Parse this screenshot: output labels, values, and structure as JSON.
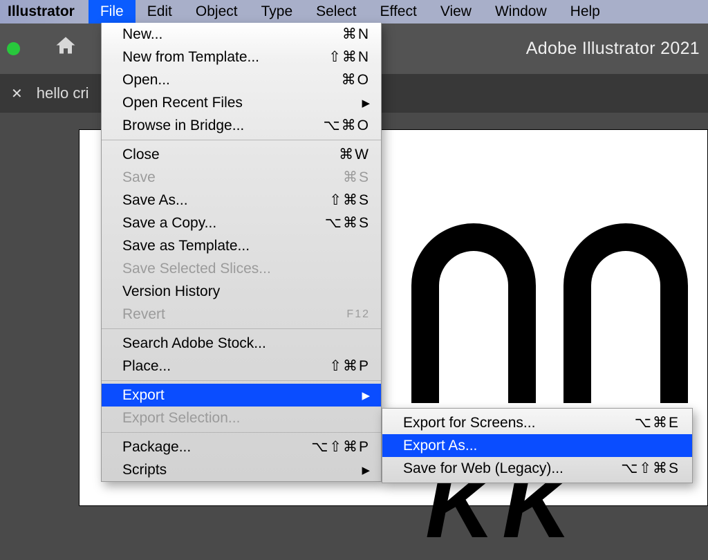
{
  "menubar": {
    "brand": "Illustrator",
    "items": [
      "File",
      "Edit",
      "Object",
      "Type",
      "Select",
      "Effect",
      "View",
      "Window",
      "Help"
    ],
    "active": "File"
  },
  "header": {
    "app_title": "Adobe Illustrator 2021"
  },
  "tabs": {
    "close_glyph": "✕",
    "active_tab": "hello cri"
  },
  "menu": {
    "items": [
      {
        "label": "New...",
        "shortcut": "⌘N",
        "disabled": false
      },
      {
        "label": "New from Template...",
        "shortcut": "⇧⌘N",
        "disabled": false
      },
      {
        "label": "Open...",
        "shortcut": "⌘O",
        "disabled": false
      },
      {
        "label": "Open Recent Files",
        "submenu": true,
        "disabled": false
      },
      {
        "label": "Browse in Bridge...",
        "shortcut": "⌥⌘O",
        "disabled": false
      },
      {
        "sep": true
      },
      {
        "label": "Close",
        "shortcut": "⌘W",
        "disabled": false
      },
      {
        "label": "Save",
        "shortcut": "⌘S",
        "disabled": true
      },
      {
        "label": "Save As...",
        "shortcut": "⇧⌘S",
        "disabled": false
      },
      {
        "label": "Save a Copy...",
        "shortcut": "⌥⌘S",
        "disabled": false
      },
      {
        "label": "Save as Template...",
        "shortcut": "",
        "disabled": false
      },
      {
        "label": "Save Selected Slices...",
        "shortcut": "",
        "disabled": true
      },
      {
        "label": "Version History",
        "shortcut": "",
        "disabled": false
      },
      {
        "label": "Revert",
        "shortcut": "F12",
        "disabled": true
      },
      {
        "sep": true
      },
      {
        "label": "Search Adobe Stock...",
        "shortcut": "",
        "disabled": false
      },
      {
        "label": "Place...",
        "shortcut": "⇧⌘P",
        "disabled": false
      },
      {
        "sep": true
      },
      {
        "label": "Export",
        "submenu": true,
        "disabled": false,
        "highlight": true
      },
      {
        "label": "Export Selection...",
        "shortcut": "",
        "disabled": true
      },
      {
        "sep": true
      },
      {
        "label": "Package...",
        "shortcut": "⌥⇧⌘P",
        "disabled": false
      },
      {
        "label": "Scripts",
        "submenu": true,
        "disabled": false
      }
    ]
  },
  "submenu_export": {
    "items": [
      {
        "label": "Export for Screens...",
        "shortcut": "⌥⌘E"
      },
      {
        "label": "Export As...",
        "shortcut": "",
        "highlight": true
      },
      {
        "label": "Save for Web (Legacy)...",
        "shortcut": "⌥⇧⌘S"
      }
    ]
  }
}
